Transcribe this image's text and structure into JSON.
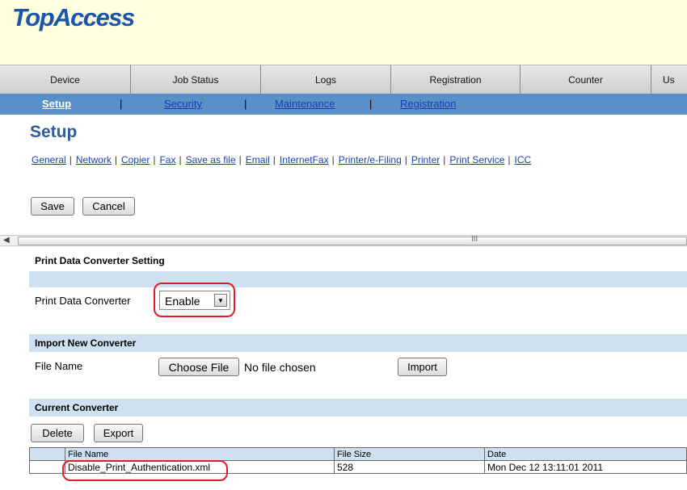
{
  "app": {
    "logo": "TopAccess"
  },
  "tabs": [
    "Device",
    "Job Status",
    "Logs",
    "Registration",
    "Counter",
    "Us"
  ],
  "subnav": {
    "items": [
      "Setup",
      "Security",
      "Maintenance",
      "Registration"
    ],
    "separator": "|"
  },
  "page_title": "Setup",
  "settings_links": [
    "General",
    "Network",
    "Copier",
    "Fax",
    "Save as file",
    "Email",
    "InternetFax",
    "Printer/e-Filing",
    "Printer",
    "Print Service",
    "ICC"
  ],
  "settings_sep": "|",
  "actions": {
    "save": "Save",
    "cancel": "Cancel"
  },
  "scrollbar": {
    "grip": "III"
  },
  "pdc": {
    "title": "Print Data Converter Setting",
    "label": "Print Data Converter",
    "value": "Enable"
  },
  "import": {
    "title": "Import New Converter",
    "file_label": "File Name",
    "choose_file": "Choose File",
    "no_file": "No file chosen",
    "import_button": "Import"
  },
  "current": {
    "title": "Current Converter",
    "delete": "Delete",
    "export": "Export",
    "columns": [
      "",
      "File Name",
      "File Size",
      "Date"
    ],
    "rows": [
      {
        "file": "Disable_Print_Authentication.xml",
        "size": "528",
        "date": "Mon Dec 12 13:11:01 2011"
      }
    ]
  },
  "colors": {
    "accent": "#5a8fc8",
    "band": "#cfe0f1",
    "header": "#fefee0",
    "highlight": "#e21c24"
  }
}
